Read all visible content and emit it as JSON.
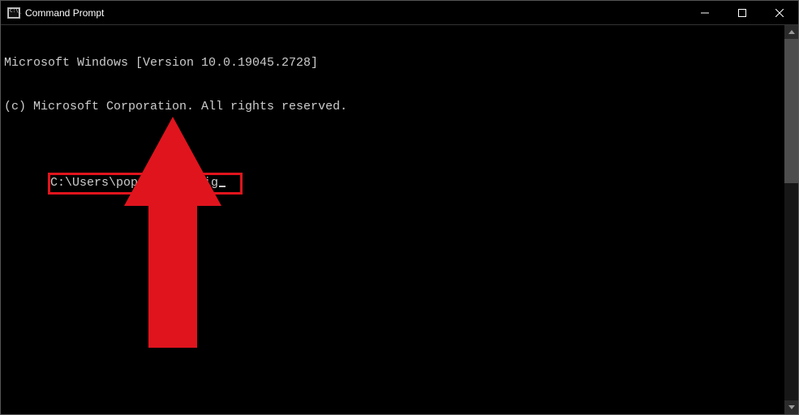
{
  "window": {
    "title": "Command Prompt"
  },
  "terminal": {
    "line1": "Microsoft Windows [Version 10.0.19045.2728]",
    "line2": "(c) Microsoft Corporation. All rights reserved.",
    "prompt": "C:\\Users\\popaa>",
    "command": "ipconfig"
  },
  "annotation": {
    "highlight_color": "#e0141d",
    "arrow_color": "#e0141d"
  }
}
